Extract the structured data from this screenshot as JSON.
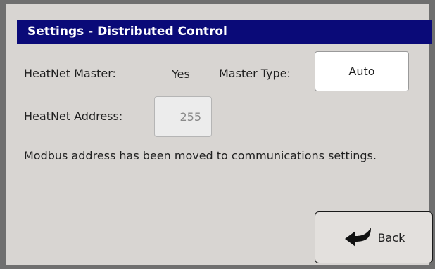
{
  "header": {
    "title": "Settings - Distributed Control"
  },
  "fields": {
    "heatnet_master_label": "HeatNet Master:",
    "heatnet_master_value": "Yes",
    "master_type_label": "Master Type:",
    "master_type_value": "Auto",
    "heatnet_address_label": "HeatNet Address:",
    "heatnet_address_value": "255"
  },
  "note": {
    "text": "Modbus address has been moved to communications settings."
  },
  "actions": {
    "back_label": "Back",
    "back_icon": "back-arrow-icon"
  },
  "colors": {
    "titlebar_bg": "#0a0a78",
    "titlebar_fg": "#ffffff",
    "panel_bg": "#d8d5d2",
    "frame_border": "#6f6f6f"
  }
}
